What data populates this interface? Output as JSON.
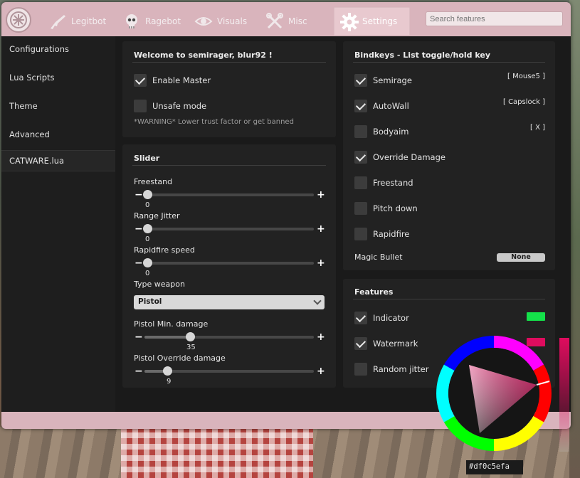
{
  "header": {
    "tabs": [
      {
        "label": "Legitbot",
        "icon": "rifle-icon"
      },
      {
        "label": "Ragebot",
        "icon": "skull-icon"
      },
      {
        "label": "Visuals",
        "icon": "eye-icon"
      },
      {
        "label": "Misc",
        "icon": "tools-icon"
      },
      {
        "label": "Settings",
        "icon": "gear-icon",
        "active": true
      }
    ],
    "search_placeholder": "Search features"
  },
  "sidebar": {
    "items": [
      {
        "label": "Configurations"
      },
      {
        "label": "Lua Scripts"
      },
      {
        "label": "Theme"
      },
      {
        "label": "Advanced"
      },
      {
        "label": "CATWARE.lua",
        "active": true
      }
    ]
  },
  "welcome": {
    "title": "Welcome to semirager, blur92 !",
    "enable_master": {
      "label": "Enable Master",
      "checked": true
    },
    "unsafe_mode": {
      "label": "Unsafe mode",
      "checked": false
    },
    "warning": "*WARNING* Lower trust factor or get banned"
  },
  "slider_panel": {
    "title": "Slider",
    "sliders": [
      {
        "label": "Freestand",
        "value": "0",
        "fraction": 0.0
      },
      {
        "label": "Range Jitter",
        "value": "0",
        "fraction": 0.0
      },
      {
        "label": "Rapidfire speed",
        "value": "0",
        "fraction": 0.0
      }
    ],
    "type_weapon": {
      "label": "Type weapon",
      "selected": "Pistol"
    },
    "sliders2": [
      {
        "label": "Pistol Min. damage",
        "value": "35",
        "fraction": 0.27
      },
      {
        "label": "Pistol Override damage",
        "value": "9",
        "fraction": 0.14
      }
    ]
  },
  "bindkeys": {
    "title": "Bindkeys - List toggle/hold key",
    "items": [
      {
        "label": "Semirage",
        "checked": true,
        "key": "[ Mouse5 ]"
      },
      {
        "label": "AutoWall",
        "checked": true,
        "key": "[ Capslock ]"
      },
      {
        "label": "Bodyaim",
        "checked": false,
        "key": "[ X ]"
      },
      {
        "label": "Override Damage",
        "checked": true,
        "key": ""
      },
      {
        "label": "Freestand",
        "checked": false,
        "key": ""
      },
      {
        "label": "Pitch down",
        "checked": false,
        "key": ""
      },
      {
        "label": "Rapidfire",
        "checked": false,
        "key": ""
      }
    ],
    "magic_bullet": {
      "label": "Magic Bullet",
      "value": "None"
    }
  },
  "features": {
    "title": "Features",
    "items": [
      {
        "label": "Indicator",
        "checked": true,
        "color": "#14e14a"
      },
      {
        "label": "Watermark",
        "checked": true,
        "color": "#df0c5e"
      },
      {
        "label": "Random jitter",
        "checked": false,
        "color": ""
      }
    ]
  },
  "color_picker": {
    "hex": "#df0c5efa"
  },
  "colors": {
    "accent": "#d9b4bc",
    "panel": "#222222",
    "window": "#1a1a1a"
  }
}
